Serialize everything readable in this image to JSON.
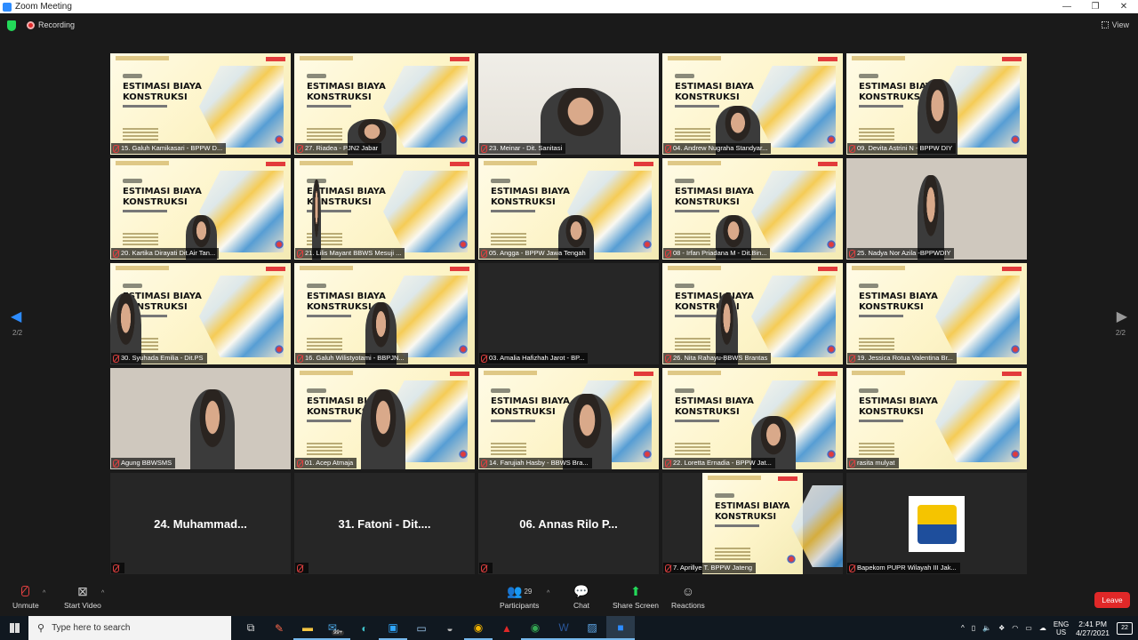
{
  "window": {
    "title": "Zoom Meeting",
    "min": "—",
    "restore": "❐",
    "close": "✕"
  },
  "meeting": {
    "recording_label": "Recording",
    "view_label": "View"
  },
  "slide": {
    "label": "PELATIHAN",
    "title_line1": "ESTIMASI BIAYA",
    "title_line2": "KONSTRUKSI"
  },
  "participants": [
    {
      "name": "15. Galuh Kamikasari - BPPW D..."
    },
    {
      "name": "27. Riadea - PJN2 Jabar"
    },
    {
      "name": "23. Meinar - Dit. Sanitasi"
    },
    {
      "name": "04. Andrew Nugraha Standyar..."
    },
    {
      "name": "09. Devita Astrini N - BPPW DIY"
    },
    {
      "name": "20. Kartika Dirayati Dit.Air Tan..."
    },
    {
      "name": "21. Lilis Mayant BBWS Mesuji ..."
    },
    {
      "name": "05. Angga - BPPW Jawa Tengah"
    },
    {
      "name": "08 - Irfan Priadana M - Dit.Bin..."
    },
    {
      "name": "25. Nadya Nor Azila -BPPWDIY"
    },
    {
      "name": "30. Syuhada Emilia - Dit.PS"
    },
    {
      "name": "16. Galuh Wilistyotami - BBPJN..."
    },
    {
      "name": "03. Amalia Hafizhah Jarot - BP..."
    },
    {
      "name": "26. Nita Rahayu-BBWS Brantas"
    },
    {
      "name": "19. Jessica Rotua Valentina Br..."
    },
    {
      "name": "Agung BBWSMS"
    },
    {
      "name": "01. Acep Atmaja"
    },
    {
      "name": "14. Farujiah Hasby - BBWS Bra..."
    },
    {
      "name": "22. Loretta Ernadia - BPPW Jat..."
    },
    {
      "name": "rasita mulyat"
    },
    {
      "name": "",
      "big_name": "24.  Muhammad..."
    },
    {
      "name": "",
      "big_name": "31.  Fatoni - Dit...."
    },
    {
      "name": "",
      "big_name": "06.  Annas Rilo P..."
    },
    {
      "name": "7. Aprillye T. BPPW Jateng"
    },
    {
      "name": "Bapekom PUPR Wilayah III Jak..."
    }
  ],
  "paging": {
    "left": "2/2",
    "right": "2/2"
  },
  "toolbar": {
    "unmute": "Unmute",
    "start_video": "Start Video",
    "participants_label": "Participants",
    "participants_count": "29",
    "chat": "Chat",
    "share_screen": "Share Screen",
    "reactions": "Reactions",
    "leave": "Leave"
  },
  "taskbar": {
    "search_placeholder": "Type here to search",
    "mail_badge": "99+",
    "lang_top": "ENG",
    "lang_bottom": "US",
    "time": "2:41 PM",
    "date": "4/27/2021",
    "notifications": "22"
  }
}
